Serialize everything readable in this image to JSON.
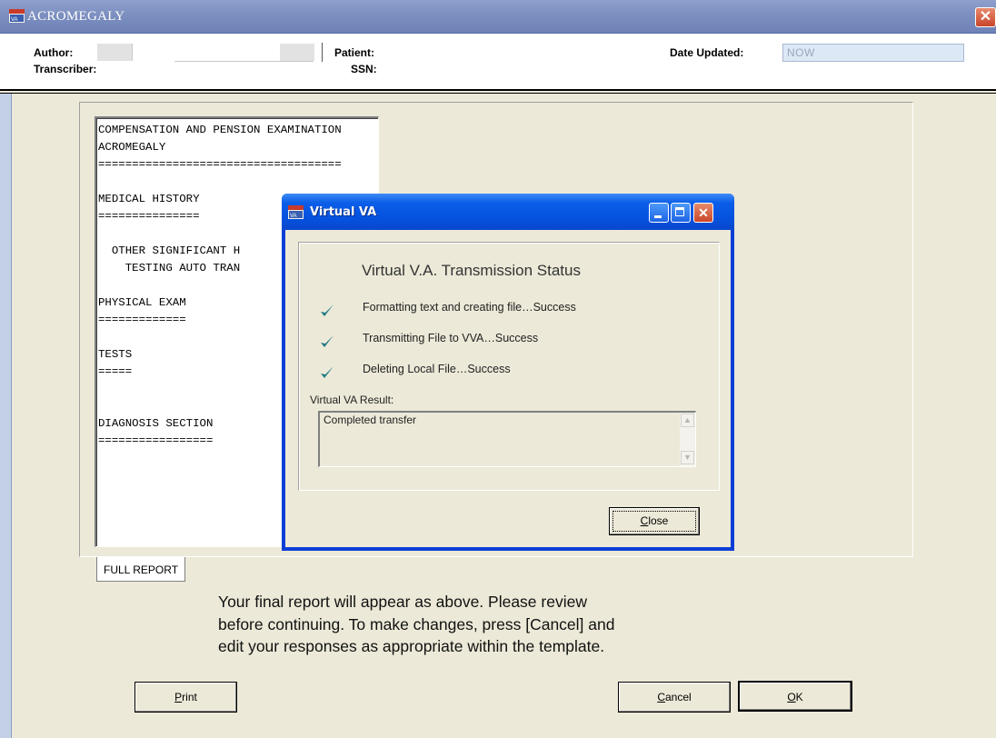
{
  "window": {
    "title": "ACROMEGALY"
  },
  "header": {
    "author_label": "Author:",
    "transcriber_label": "Transcriber:",
    "patient_label": "Patient:",
    "ssn_label": "SSN:",
    "date_label": "Date Updated:",
    "date_value": "NOW"
  },
  "report": {
    "lines": [
      "COMPENSATION AND PENSION EXAMINATION",
      "ACROMEGALY",
      "====================================",
      "",
      "MEDICAL HISTORY",
      "===============",
      "",
      "  OTHER SIGNIFICANT H",
      "    TESTING AUTO TRAN",
      "",
      "PHYSICAL EXAM",
      "=============",
      "",
      "TESTS",
      "=====",
      "",
      "",
      "DIAGNOSIS SECTION",
      "================="
    ],
    "tab_label": "FULL REPORT"
  },
  "instructions": [
    "Your final report will appear as above.  Please review",
    "before continuing.  To make changes, press [Cancel] and",
    "edit your responses as appropriate within the template."
  ],
  "buttons": {
    "print": "Print",
    "cancel": "Cancel",
    "ok": "OK"
  },
  "dialog": {
    "title": "Virtual VA",
    "status_title": "Virtual V.A. Transmission Status",
    "steps": [
      "Formatting text and creating file…Success",
      "Transmitting File to VVA…Success",
      "Deleting Local File…Success"
    ],
    "result_label": "Virtual VA Result:",
    "result_text": "Completed transfer",
    "close_label": "Close"
  },
  "colors": {
    "check": "#1f7a82",
    "dialog_titlebar": "#0551de",
    "window_titlebar": "#7d8fc0"
  },
  "icons": {
    "app": "app-logo-icon",
    "check": "checkmark-icon"
  }
}
